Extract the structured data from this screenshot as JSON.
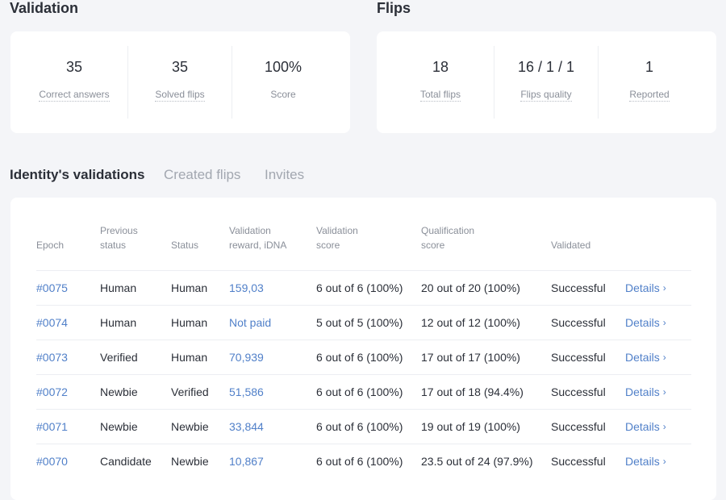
{
  "validation": {
    "title": "Validation",
    "stats": [
      {
        "value": "35",
        "label": "Correct answers"
      },
      {
        "value": "35",
        "label": "Solved flips"
      },
      {
        "value": "100%",
        "label": "Score"
      }
    ]
  },
  "flips": {
    "title": "Flips",
    "stats": [
      {
        "value": "18",
        "label": "Total flips"
      },
      {
        "value": "16 / 1 / 1",
        "label": "Flips quality"
      },
      {
        "value": "1",
        "label": "Reported"
      }
    ]
  },
  "tabs": [
    "Identity's validations",
    "Created flips",
    "Invites"
  ],
  "table": {
    "headers": {
      "epoch": "Epoch",
      "prev_status": [
        "Previous",
        "status"
      ],
      "status": "Status",
      "reward": [
        "Validation",
        "reward, iDNA"
      ],
      "vscore": [
        "Validation",
        "score"
      ],
      "qscore": [
        "Qualification",
        "score"
      ],
      "validated": "Validated"
    },
    "rows": [
      {
        "epoch": "#0075",
        "prev": "Human",
        "status": "Human",
        "reward": "159,03",
        "vscore": "6 out of 6 (100%)",
        "qscore": "20 out of 20 (100%)",
        "validated": "Successful",
        "details": "Details"
      },
      {
        "epoch": "#0074",
        "prev": "Human",
        "status": "Human",
        "reward": "Not paid",
        "vscore": "5 out of 5 (100%)",
        "qscore": "12 out of 12 (100%)",
        "validated": "Successful",
        "details": "Details"
      },
      {
        "epoch": "#0073",
        "prev": "Verified",
        "status": "Human",
        "reward": "70,939",
        "vscore": "6 out of 6 (100%)",
        "qscore": "17 out of 17 (100%)",
        "validated": "Successful",
        "details": "Details"
      },
      {
        "epoch": "#0072",
        "prev": "Newbie",
        "status": "Verified",
        "reward": "51,586",
        "vscore": "6 out of 6 (100%)",
        "qscore": "17 out of 18 (94.4%)",
        "validated": "Successful",
        "details": "Details"
      },
      {
        "epoch": "#0071",
        "prev": "Newbie",
        "status": "Newbie",
        "reward": "33,844",
        "vscore": "6 out of 6 (100%)",
        "qscore": "19 out of 19 (100%)",
        "validated": "Successful",
        "details": "Details"
      },
      {
        "epoch": "#0070",
        "prev": "Candidate",
        "status": "Newbie",
        "reward": "10,867",
        "vscore": "6 out of 6 (100%)",
        "qscore": "23.5 out of 24 (97.9%)",
        "validated": "Successful",
        "details": "Details"
      }
    ]
  },
  "colors": {
    "link": "#5180c9",
    "muted": "#8a8f99",
    "background": "#f4f5f8"
  }
}
